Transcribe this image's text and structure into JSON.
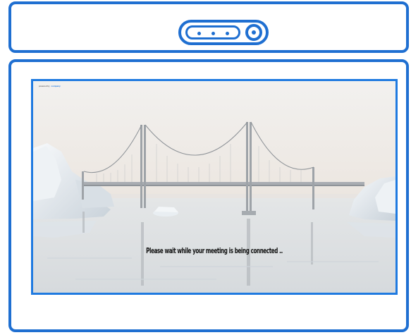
{
  "device": {
    "camera_icon": "webcam-icon",
    "frame_color": "#1f6fd1"
  },
  "meeting": {
    "powered_by_label": "powered by",
    "brand_label": "company",
    "status_message": "Please wait while your meeting is being connected ..",
    "background_icon": "bridge-scene-image",
    "accent_color": "#1f7ae0"
  }
}
